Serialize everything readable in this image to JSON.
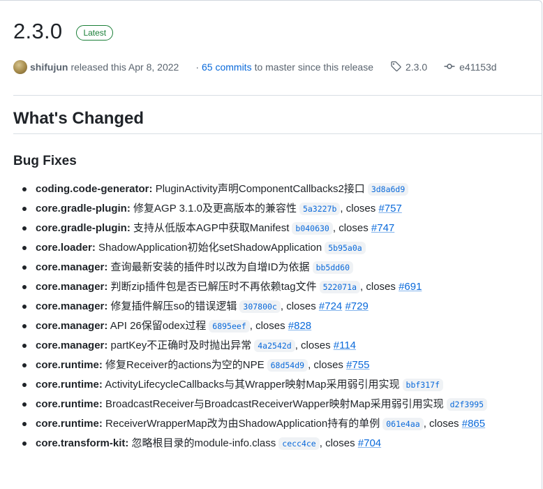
{
  "release": {
    "version": "2.3.0",
    "badge": "Latest",
    "author": "shifujun",
    "released_text": "released this Apr 8, 2022",
    "commits_link": "65 commits",
    "commits_suffix": "to master since this release",
    "tag": "2.3.0",
    "commit": "e41153d"
  },
  "body": {
    "heading": "What's Changed",
    "subheading": "Bug Fixes",
    "closes_word": ", closes",
    "items": [
      {
        "scope": "coding.code-generator:",
        "text": "PluginActivity声明ComponentCallbacks2接口",
        "sha": "3d8a6d9",
        "issues": []
      },
      {
        "scope": "core.gradle-plugin:",
        "text": "修复AGP 3.1.0及更高版本的兼容性",
        "sha": "5a3227b",
        "issues": [
          "#757"
        ]
      },
      {
        "scope": "core.gradle-plugin:",
        "text": "支持从低版本AGP中获取Manifest",
        "sha": "b040630",
        "issues": [
          "#747"
        ]
      },
      {
        "scope": "core.loader:",
        "text": "ShadowApplication初始化setShadowApplication",
        "sha": "5b95a0a",
        "issues": []
      },
      {
        "scope": "core.manager:",
        "text": "查询最新安装的插件时以改为自增ID为依据",
        "sha": "bb5dd60",
        "issues": []
      },
      {
        "scope": "core.manager:",
        "text": "判断zip插件包是否已解压时不再依赖tag文件",
        "sha": "522071a",
        "issues": [
          "#691"
        ]
      },
      {
        "scope": "core.manager:",
        "text": "修复插件解压so的错误逻辑",
        "sha": "307800c",
        "issues": [
          "#724",
          "#729"
        ]
      },
      {
        "scope": "core.manager:",
        "text": "API 26保留odex过程",
        "sha": "6895eef",
        "issues": [
          "#828"
        ]
      },
      {
        "scope": "core.manager:",
        "text": "partKey不正确时及时抛出异常",
        "sha": "4a2542d",
        "issues": [
          "#114"
        ]
      },
      {
        "scope": "core.runtime:",
        "text": "修复Receiver的actions为空的NPE",
        "sha": "68d54d9",
        "issues": [
          "#755"
        ]
      },
      {
        "scope": "core.runtime:",
        "text": "ActivityLifecycleCallbacks与其Wrapper映射Map采用弱引用实现",
        "sha": "bbf317f",
        "issues": []
      },
      {
        "scope": "core.runtime:",
        "text": "BroadcastReceiver与BroadcastReceiverWapper映射Map采用弱引用实现",
        "sha": "d2f3995",
        "issues": []
      },
      {
        "scope": "core.runtime:",
        "text": "ReceiverWrapperMap改为由ShadowApplication持有的单例",
        "sha": "061e4aa",
        "issues": [
          "#865"
        ]
      },
      {
        "scope": "core.transform-kit:",
        "text": "忽略根目录的module-info.class",
        "sha": "cecc4ce",
        "issues": [
          "#704"
        ]
      }
    ]
  },
  "colors": {
    "link": "#0969da",
    "badge_green": "#1a7f37",
    "text": "#1f2328",
    "muted": "#59636e"
  },
  "icons": {
    "tag": "tag-icon",
    "commit": "git-commit-icon",
    "avatar": "avatar"
  }
}
